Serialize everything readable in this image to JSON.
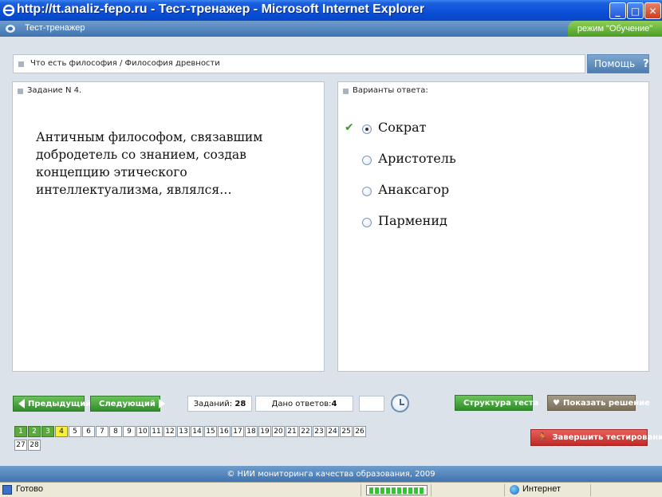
{
  "window": {
    "title": "http://tt.analiz-fepo.ru - Тест-тренажер - Microsoft Internet Explorer",
    "minimize": "_",
    "maximize": "□",
    "close": "✕"
  },
  "app": {
    "title": "Тест-тренажер",
    "mode": "режим \"Обучение\""
  },
  "breadcrumb": "Что есть философия / Философия древности",
  "help": {
    "label": "Помощь",
    "icon": "?"
  },
  "task": {
    "header": "Задание N 4.",
    "question": "Античным философом, связавшим добродетель со знанием, создав концепцию этического интеллектуализма, являлся…"
  },
  "answers": {
    "header": "Варианты ответа:",
    "options": [
      {
        "label": "Сократ",
        "selected": true,
        "correct": true
      },
      {
        "label": "Аристотель",
        "selected": false,
        "correct": false
      },
      {
        "label": "Анаксагор",
        "selected": false,
        "correct": false
      },
      {
        "label": "Парменид",
        "selected": false,
        "correct": false
      }
    ]
  },
  "controls": {
    "prev": "Предыдущий",
    "next": "Следующий",
    "tasks_label": "Заданий:",
    "tasks_count": "28",
    "answers_label": "Дано ответов:",
    "answers_count": "4",
    "timer": "",
    "structure": "Структура теста",
    "show_solution": "Показать решение",
    "finish": "Завершить тестирование"
  },
  "task_nav": {
    "items": [
      "1",
      "2",
      "3",
      "4",
      "5",
      "6",
      "7",
      "8",
      "9",
      "10",
      "11",
      "12",
      "13",
      "14",
      "15",
      "16",
      "17",
      "18",
      "19",
      "20",
      "21",
      "22",
      "23",
      "24",
      "25",
      "26",
      "27",
      "28"
    ],
    "done": [
      "1",
      "2",
      "3"
    ],
    "current": "4"
  },
  "footer": "© НИИ мониторинга качества образования, 2009",
  "status": {
    "text": "Готово",
    "zone": "Интернет"
  },
  "colors": {
    "titlebar": "#0a4fd8",
    "header": "#3f74b0",
    "green": "#2f8d2a",
    "red": "#c22a26",
    "current": "#f6ef3c"
  }
}
